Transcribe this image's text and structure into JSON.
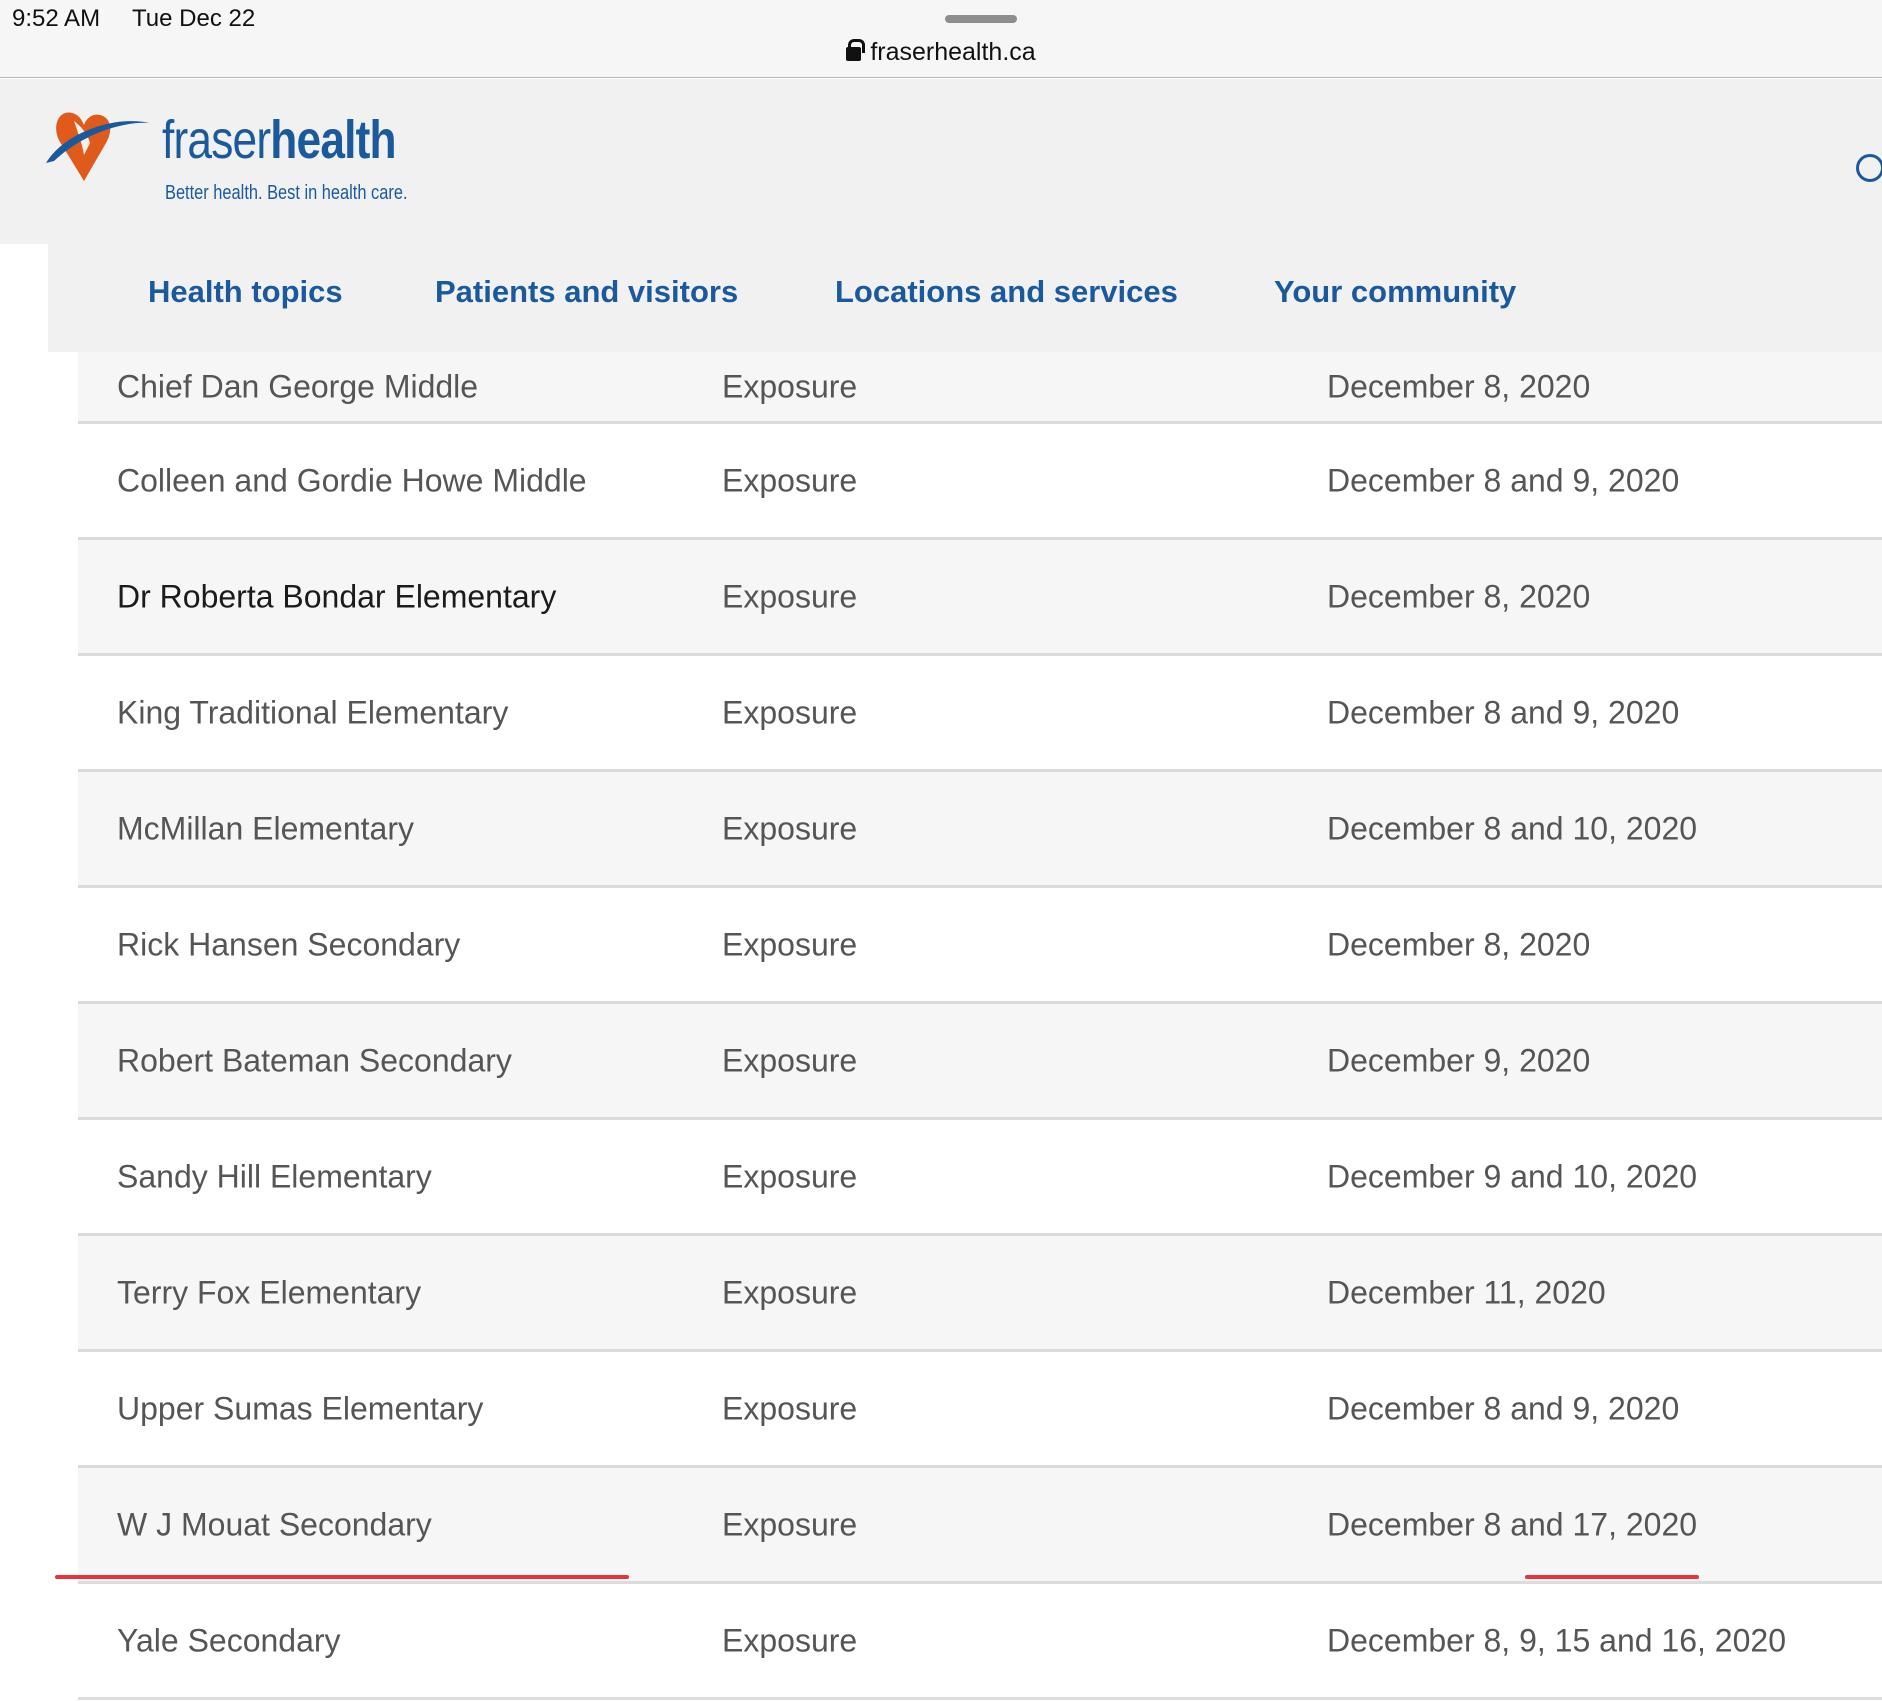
{
  "status_bar": {
    "time": "9:52 AM",
    "date": "Tue Dec 22"
  },
  "browser": {
    "url": "fraserhealth.ca"
  },
  "brand": {
    "name_part1": "fraser",
    "name_part2": "health",
    "tagline": "Better health. Best in health care.",
    "primary_color": "#1a5a9c",
    "accent_color": "#e05a1c"
  },
  "nav": {
    "items": [
      {
        "label": "Health topics"
      },
      {
        "label": "Patients and visitors"
      },
      {
        "label": "Locations and services"
      },
      {
        "label": "Your community"
      }
    ]
  },
  "table": {
    "rows": [
      {
        "school": "Chief Dan George Middle",
        "type": "Exposure",
        "date": "December 8, 2020"
      },
      {
        "school": "Colleen and Gordie Howe Middle",
        "type": "Exposure",
        "date": "December 8 and 9, 2020"
      },
      {
        "school": "Dr Roberta Bondar Elementary",
        "type": "Exposure",
        "date": "December 8, 2020"
      },
      {
        "school": "King Traditional Elementary",
        "type": "Exposure",
        "date": "December 8 and 9, 2020"
      },
      {
        "school": "McMillan Elementary",
        "type": "Exposure",
        "date": "December 8 and 10, 2020"
      },
      {
        "school": "Rick Hansen Secondary",
        "type": "Exposure",
        "date": "December 8, 2020"
      },
      {
        "school": "Robert Bateman Secondary",
        "type": "Exposure",
        "date": "December 9, 2020"
      },
      {
        "school": "Sandy Hill Elementary",
        "type": "Exposure",
        "date": "December 9 and 10, 2020"
      },
      {
        "school": "Terry Fox Elementary",
        "type": "Exposure",
        "date": "December 11, 2020"
      },
      {
        "school": "Upper Sumas Elementary",
        "type": "Exposure",
        "date": "December 8 and 9, 2020"
      },
      {
        "school": "W J Mouat Secondary",
        "type": "Exposure",
        "date": "December 8 and 17,  2020"
      },
      {
        "school": "Yale Secondary",
        "type": "Exposure",
        "date": "December 8, 9, 15 and 16, 2020"
      }
    ]
  },
  "annotation_color": "#e8333b"
}
